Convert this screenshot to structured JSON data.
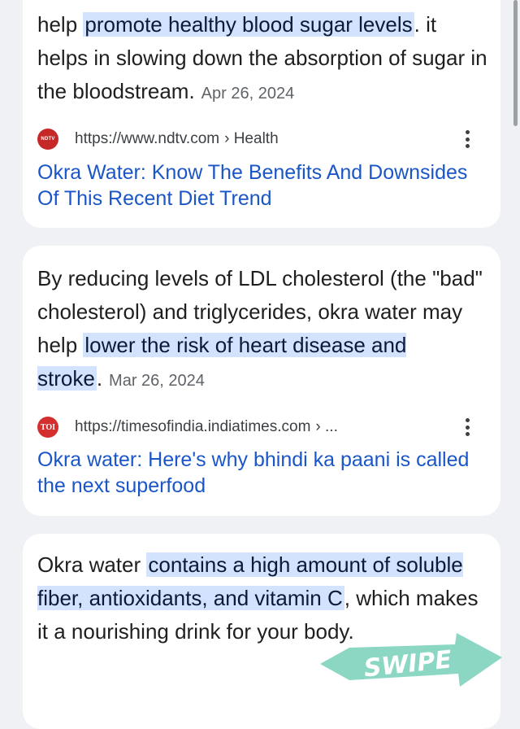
{
  "results": [
    {
      "snippet_before": "help ",
      "snippet_highlight": "promote healthy blood sugar levels",
      "snippet_after": ". it helps in slowing down the absorption of sugar in the bloodstream.",
      "date": "Apr 26, 2024",
      "favicon_text": "NDTV",
      "url": "https://www.ndtv.com",
      "breadcrumb": "› Health",
      "title": "Okra Water: Know The Benefits And Downsides Of This Recent Diet Trend"
    },
    {
      "snippet_before": "By reducing levels of LDL cholesterol (the \"bad\" cholesterol) and triglycerides, okra water may help ",
      "snippet_highlight": "lower the risk of heart disease and stroke",
      "snippet_after": ".",
      "date": "Mar 26, 2024",
      "favicon_text": "TOI",
      "url": "https://timesofindia.indiatimes.com",
      "breadcrumb": "› ...",
      "title": "Okra water: Here's why bhindi ka paani is called the next superfood"
    },
    {
      "snippet_before": "Okra water ",
      "snippet_highlight": "contains a high amount of soluble fiber, antioxidants, and vitamin C",
      "snippet_after": ", which makes it a nourishing drink for your body."
    }
  ],
  "swipe_label": "SWIPE",
  "colors": {
    "page_bg": "#f0f1f4",
    "card_bg": "#ffffff",
    "highlight_bg": "#d3e3fd",
    "link": "#1a56c7",
    "swipe": "#7fd3be"
  },
  "icons": {
    "more": "more-vert-icon",
    "ndtv": "ndtv-favicon-icon",
    "toi": "toi-favicon-icon"
  }
}
